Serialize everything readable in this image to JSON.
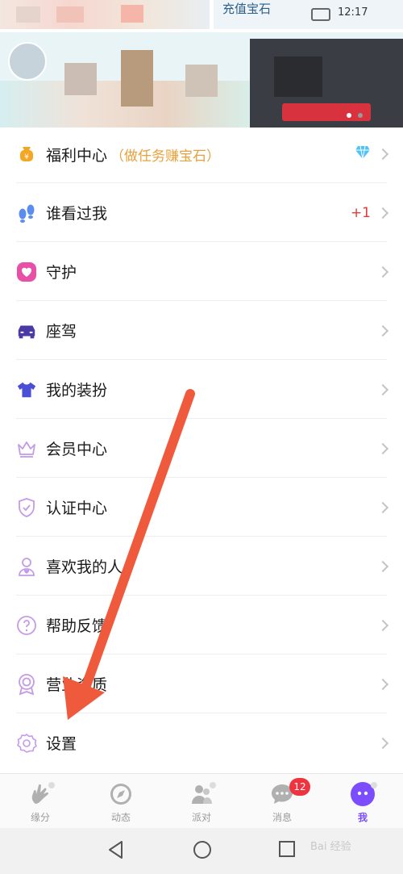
{
  "header": {
    "pixel_text": "充值宝石",
    "time": "12:17"
  },
  "menu": {
    "items": [
      {
        "label": "福利中心",
        "sub": "（做任务赚宝石）",
        "icon": "gift-bag-icon",
        "trailing": "diamond"
      },
      {
        "label": "谁看过我",
        "icon": "footprints-icon",
        "trailing": "+1"
      },
      {
        "label": "守护",
        "icon": "heart-icon"
      },
      {
        "label": "座驾",
        "icon": "car-icon"
      },
      {
        "label": "我的装扮",
        "icon": "tshirt-icon"
      },
      {
        "label": "会员中心",
        "icon": "crown-icon"
      },
      {
        "label": "认证中心",
        "icon": "shield-check-icon"
      },
      {
        "label": "喜欢我的人",
        "icon": "person-heart-icon"
      },
      {
        "label": "帮助反馈",
        "icon": "question-icon"
      },
      {
        "label": "营业资质",
        "icon": "award-icon"
      },
      {
        "label": "设置",
        "icon": "gear-icon"
      }
    ]
  },
  "tabs": [
    {
      "label": "缘分",
      "icon": "hand-icon"
    },
    {
      "label": "动态",
      "icon": "compass-icon"
    },
    {
      "label": "派对",
      "icon": "people-icon"
    },
    {
      "label": "消息",
      "icon": "chat-icon",
      "badge": "12"
    },
    {
      "label": "我",
      "icon": "me-icon",
      "active": true
    }
  ],
  "watermark": "Bai 经验",
  "colors": {
    "accent": "#7b4dff",
    "subtitle_orange": "#e6a23c",
    "badge_red": "#f0343f",
    "arrow_red": "#f05a3c"
  }
}
